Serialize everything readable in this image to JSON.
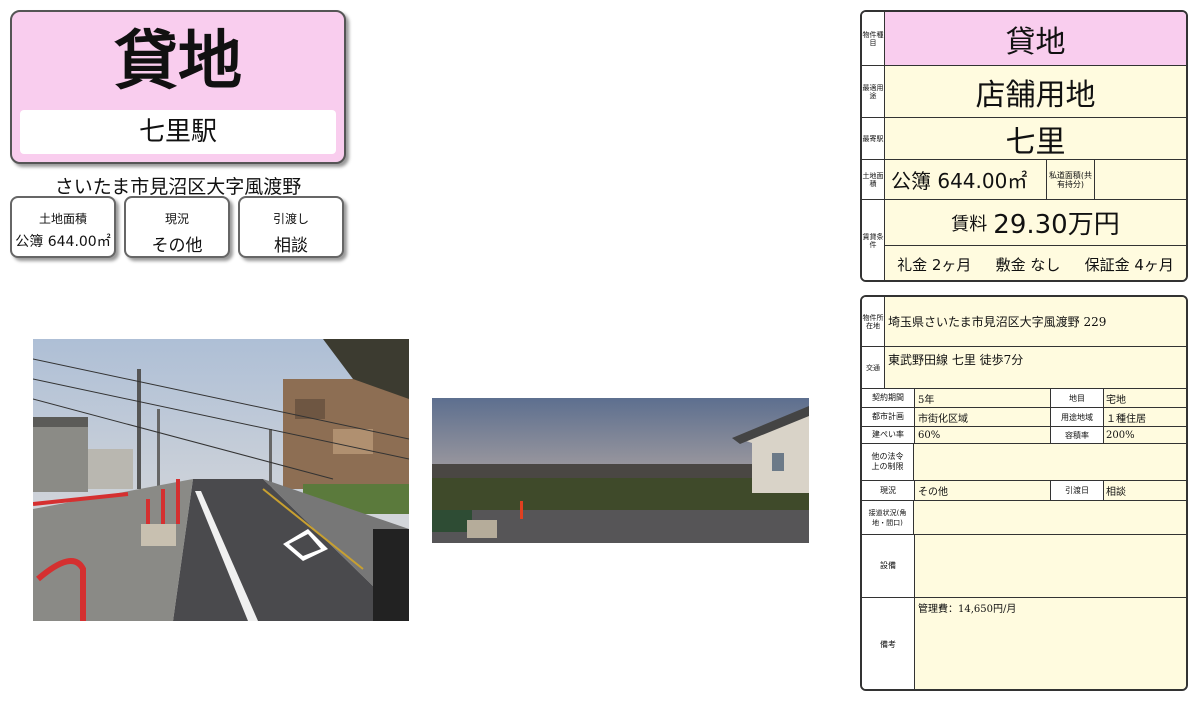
{
  "title": "貸地",
  "station": "七里駅",
  "address_short": "さいたま市見沼区大字風渡野",
  "chips": [
    {
      "label": "土地面積",
      "value": "公簿 644.00㎡"
    },
    {
      "label": "現況",
      "value": "その他"
    },
    {
      "label": "引渡し",
      "value": "相談"
    }
  ],
  "summary": {
    "type_header": "物件種目",
    "type_value": "貸地",
    "use_header": "最適用途",
    "use_value": "店舗用地",
    "station_header": "最寄駅",
    "station_value": "七里",
    "area_header": "土地面積",
    "area_value": "公簿 644.00㎡",
    "private_road_label": "私道面積(共有持分)",
    "terms_header": "賃貸条件",
    "rent_label": "賃料",
    "rent_value": "29.30万円",
    "key_money": "礼金 2ヶ月",
    "deposit": "敷金 なし",
    "guarantee": "保証金 4ヶ月"
  },
  "details": {
    "location_header": "物件所在地",
    "location_value": "埼玉県さいたま市見沼区大字風渡野 229",
    "transport_header": "交通",
    "transport_value": "東武野田線 七里 徒歩7分",
    "contract_term_header": "契約期間",
    "contract_term_value": "5年",
    "land_category_header": "地目",
    "land_category_value": "宅地",
    "city_plan_header": "都市計画",
    "city_plan_value": "市街化区域",
    "zoning_header": "用途地域",
    "zoning_value": "１種住居",
    "coverage_header": "建ぺい率",
    "coverage_value": "60%",
    "far_header": "容積率",
    "far_value": "200%",
    "other_law_header": "他の法令上の制限",
    "status_header": "現況",
    "status_value": "その他",
    "handover_header": "引渡日",
    "handover_value": "相談",
    "road_header": "接道状況(角地・間口)",
    "facility_header": "設備",
    "remarks_header": "備考",
    "remarks_value": "管理費：14,650円/月"
  },
  "colors": {
    "pink": "#f9cdee",
    "cream": "#fffbdf",
    "header_pink": "#f9cdee"
  }
}
